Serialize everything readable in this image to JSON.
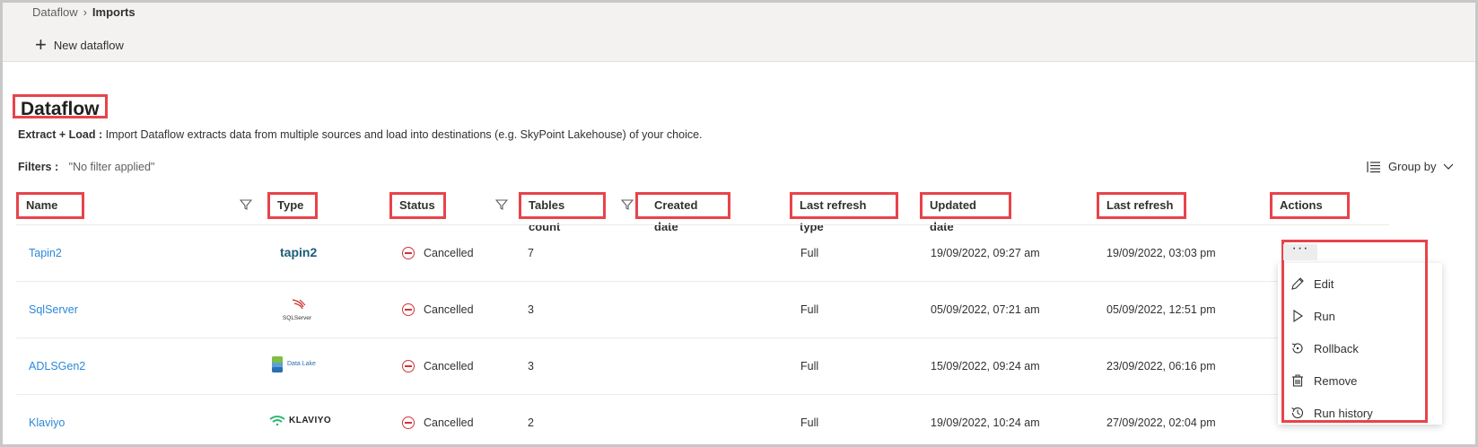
{
  "breadcrumb": {
    "root": "Dataflow",
    "current": "Imports"
  },
  "toolbar": {
    "new_dataflow": "New dataflow"
  },
  "page": {
    "title": "Dataflow",
    "desc_label": "Extract + Load :",
    "desc_text": "Import Dataflow extracts data from multiple sources and load into destinations (e.g. SkyPoint Lakehouse) of your choice.",
    "filters_label": "Filters :",
    "filters_value": "\"No filter applied\"",
    "group_by": "Group by"
  },
  "table": {
    "headers": {
      "name": "Name",
      "type": "Type",
      "status": "Status",
      "tables_count": "Tables count",
      "created_date": "Created date",
      "last_refresh_type": "Last refresh type",
      "updated_date": "Updated date",
      "last_refresh": "Last refresh",
      "actions": "Actions"
    },
    "rows": [
      {
        "name": "Tapin2",
        "type_logo": "tapin2",
        "status": "Cancelled",
        "tables_count": "7",
        "created_date": "",
        "last_refresh_type": "Full",
        "updated_date": "19/09/2022, 09:27 am",
        "last_refresh": "19/09/2022, 03:03 pm"
      },
      {
        "name": "SqlServer",
        "type_logo": "SQLServer",
        "status": "Cancelled",
        "tables_count": "3",
        "created_date": "",
        "last_refresh_type": "Full",
        "updated_date": "05/09/2022, 07:21 am",
        "last_refresh": "05/09/2022, 12:51 pm"
      },
      {
        "name": "ADLSGen2",
        "type_logo": "Data Lake",
        "status": "Cancelled",
        "tables_count": "3",
        "created_date": "",
        "last_refresh_type": "Full",
        "updated_date": "15/09/2022, 09:24 am",
        "last_refresh": "23/09/2022, 06:16 pm"
      },
      {
        "name": "Klaviyo",
        "type_logo": "KLAVIYO",
        "status": "Cancelled",
        "tables_count": "2",
        "created_date": "",
        "last_refresh_type": "Full",
        "updated_date": "19/09/2022, 10:24 am",
        "last_refresh": "27/09/2022, 02:04 pm"
      }
    ]
  },
  "actions_menu": {
    "more": "···",
    "items": [
      {
        "label": "Edit",
        "icon": "pencil-icon"
      },
      {
        "label": "Run",
        "icon": "play-icon"
      },
      {
        "label": "Rollback",
        "icon": "rollback-icon"
      },
      {
        "label": "Remove",
        "icon": "trash-icon"
      },
      {
        "label": "Run history",
        "icon": "history-icon"
      }
    ]
  },
  "colors": {
    "accent_link": "#2b88d8",
    "highlight_red": "#e8434b",
    "status_cancelled": "#d13438",
    "topbar_bg": "#f3f2f1"
  }
}
